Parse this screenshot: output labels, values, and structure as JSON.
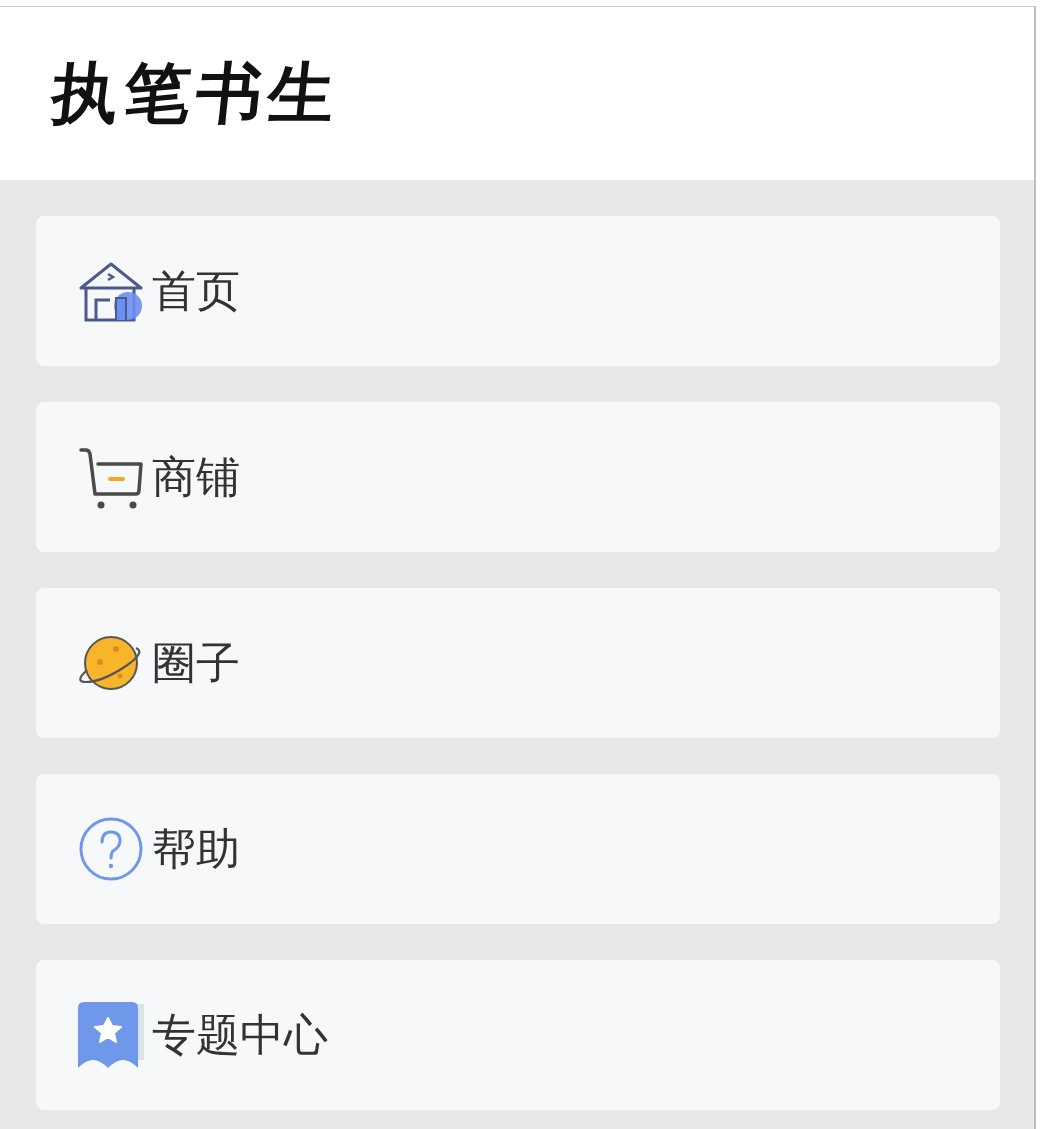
{
  "header": {
    "title": "执笔书生"
  },
  "menu": [
    {
      "kind": "home",
      "label": "首页"
    },
    {
      "kind": "cart",
      "label": "商铺"
    },
    {
      "kind": "planet",
      "label": "圈子"
    },
    {
      "kind": "help",
      "label": "帮助"
    },
    {
      "kind": "bookmark",
      "label": "专题中心"
    }
  ]
}
